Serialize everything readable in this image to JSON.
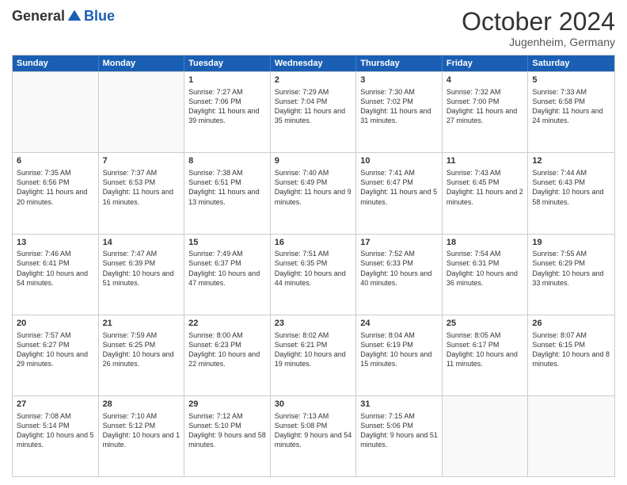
{
  "header": {
    "logo_general": "General",
    "logo_blue": "Blue",
    "month_title": "October 2024",
    "location": "Jugenheim, Germany"
  },
  "weekdays": [
    "Sunday",
    "Monday",
    "Tuesday",
    "Wednesday",
    "Thursday",
    "Friday",
    "Saturday"
  ],
  "rows": [
    [
      {
        "day": "",
        "sunrise": "",
        "sunset": "",
        "daylight": "",
        "empty": true
      },
      {
        "day": "",
        "sunrise": "",
        "sunset": "",
        "daylight": "",
        "empty": true
      },
      {
        "day": "1",
        "sunrise": "Sunrise: 7:27 AM",
        "sunset": "Sunset: 7:06 PM",
        "daylight": "Daylight: 11 hours and 39 minutes."
      },
      {
        "day": "2",
        "sunrise": "Sunrise: 7:29 AM",
        "sunset": "Sunset: 7:04 PM",
        "daylight": "Daylight: 11 hours and 35 minutes."
      },
      {
        "day": "3",
        "sunrise": "Sunrise: 7:30 AM",
        "sunset": "Sunset: 7:02 PM",
        "daylight": "Daylight: 11 hours and 31 minutes."
      },
      {
        "day": "4",
        "sunrise": "Sunrise: 7:32 AM",
        "sunset": "Sunset: 7:00 PM",
        "daylight": "Daylight: 11 hours and 27 minutes."
      },
      {
        "day": "5",
        "sunrise": "Sunrise: 7:33 AM",
        "sunset": "Sunset: 6:58 PM",
        "daylight": "Daylight: 11 hours and 24 minutes."
      }
    ],
    [
      {
        "day": "6",
        "sunrise": "Sunrise: 7:35 AM",
        "sunset": "Sunset: 6:56 PM",
        "daylight": "Daylight: 11 hours and 20 minutes."
      },
      {
        "day": "7",
        "sunrise": "Sunrise: 7:37 AM",
        "sunset": "Sunset: 6:53 PM",
        "daylight": "Daylight: 11 hours and 16 minutes."
      },
      {
        "day": "8",
        "sunrise": "Sunrise: 7:38 AM",
        "sunset": "Sunset: 6:51 PM",
        "daylight": "Daylight: 11 hours and 13 minutes."
      },
      {
        "day": "9",
        "sunrise": "Sunrise: 7:40 AM",
        "sunset": "Sunset: 6:49 PM",
        "daylight": "Daylight: 11 hours and 9 minutes."
      },
      {
        "day": "10",
        "sunrise": "Sunrise: 7:41 AM",
        "sunset": "Sunset: 6:47 PM",
        "daylight": "Daylight: 11 hours and 5 minutes."
      },
      {
        "day": "11",
        "sunrise": "Sunrise: 7:43 AM",
        "sunset": "Sunset: 6:45 PM",
        "daylight": "Daylight: 11 hours and 2 minutes."
      },
      {
        "day": "12",
        "sunrise": "Sunrise: 7:44 AM",
        "sunset": "Sunset: 6:43 PM",
        "daylight": "Daylight: 10 hours and 58 minutes."
      }
    ],
    [
      {
        "day": "13",
        "sunrise": "Sunrise: 7:46 AM",
        "sunset": "Sunset: 6:41 PM",
        "daylight": "Daylight: 10 hours and 54 minutes."
      },
      {
        "day": "14",
        "sunrise": "Sunrise: 7:47 AM",
        "sunset": "Sunset: 6:39 PM",
        "daylight": "Daylight: 10 hours and 51 minutes."
      },
      {
        "day": "15",
        "sunrise": "Sunrise: 7:49 AM",
        "sunset": "Sunset: 6:37 PM",
        "daylight": "Daylight: 10 hours and 47 minutes."
      },
      {
        "day": "16",
        "sunrise": "Sunrise: 7:51 AM",
        "sunset": "Sunset: 6:35 PM",
        "daylight": "Daylight: 10 hours and 44 minutes."
      },
      {
        "day": "17",
        "sunrise": "Sunrise: 7:52 AM",
        "sunset": "Sunset: 6:33 PM",
        "daylight": "Daylight: 10 hours and 40 minutes."
      },
      {
        "day": "18",
        "sunrise": "Sunrise: 7:54 AM",
        "sunset": "Sunset: 6:31 PM",
        "daylight": "Daylight: 10 hours and 36 minutes."
      },
      {
        "day": "19",
        "sunrise": "Sunrise: 7:55 AM",
        "sunset": "Sunset: 6:29 PM",
        "daylight": "Daylight: 10 hours and 33 minutes."
      }
    ],
    [
      {
        "day": "20",
        "sunrise": "Sunrise: 7:57 AM",
        "sunset": "Sunset: 6:27 PM",
        "daylight": "Daylight: 10 hours and 29 minutes."
      },
      {
        "day": "21",
        "sunrise": "Sunrise: 7:59 AM",
        "sunset": "Sunset: 6:25 PM",
        "daylight": "Daylight: 10 hours and 26 minutes."
      },
      {
        "day": "22",
        "sunrise": "Sunrise: 8:00 AM",
        "sunset": "Sunset: 6:23 PM",
        "daylight": "Daylight: 10 hours and 22 minutes."
      },
      {
        "day": "23",
        "sunrise": "Sunrise: 8:02 AM",
        "sunset": "Sunset: 6:21 PM",
        "daylight": "Daylight: 10 hours and 19 minutes."
      },
      {
        "day": "24",
        "sunrise": "Sunrise: 8:04 AM",
        "sunset": "Sunset: 6:19 PM",
        "daylight": "Daylight: 10 hours and 15 minutes."
      },
      {
        "day": "25",
        "sunrise": "Sunrise: 8:05 AM",
        "sunset": "Sunset: 6:17 PM",
        "daylight": "Daylight: 10 hours and 11 minutes."
      },
      {
        "day": "26",
        "sunrise": "Sunrise: 8:07 AM",
        "sunset": "Sunset: 6:15 PM",
        "daylight": "Daylight: 10 hours and 8 minutes."
      }
    ],
    [
      {
        "day": "27",
        "sunrise": "Sunrise: 7:08 AM",
        "sunset": "Sunset: 5:14 PM",
        "daylight": "Daylight: 10 hours and 5 minutes."
      },
      {
        "day": "28",
        "sunrise": "Sunrise: 7:10 AM",
        "sunset": "Sunset: 5:12 PM",
        "daylight": "Daylight: 10 hours and 1 minute."
      },
      {
        "day": "29",
        "sunrise": "Sunrise: 7:12 AM",
        "sunset": "Sunset: 5:10 PM",
        "daylight": "Daylight: 9 hours and 58 minutes."
      },
      {
        "day": "30",
        "sunrise": "Sunrise: 7:13 AM",
        "sunset": "Sunset: 5:08 PM",
        "daylight": "Daylight: 9 hours and 54 minutes."
      },
      {
        "day": "31",
        "sunrise": "Sunrise: 7:15 AM",
        "sunset": "Sunset: 5:06 PM",
        "daylight": "Daylight: 9 hours and 51 minutes."
      },
      {
        "day": "",
        "sunrise": "",
        "sunset": "",
        "daylight": "",
        "empty": true
      },
      {
        "day": "",
        "sunrise": "",
        "sunset": "",
        "daylight": "",
        "empty": true
      }
    ]
  ]
}
